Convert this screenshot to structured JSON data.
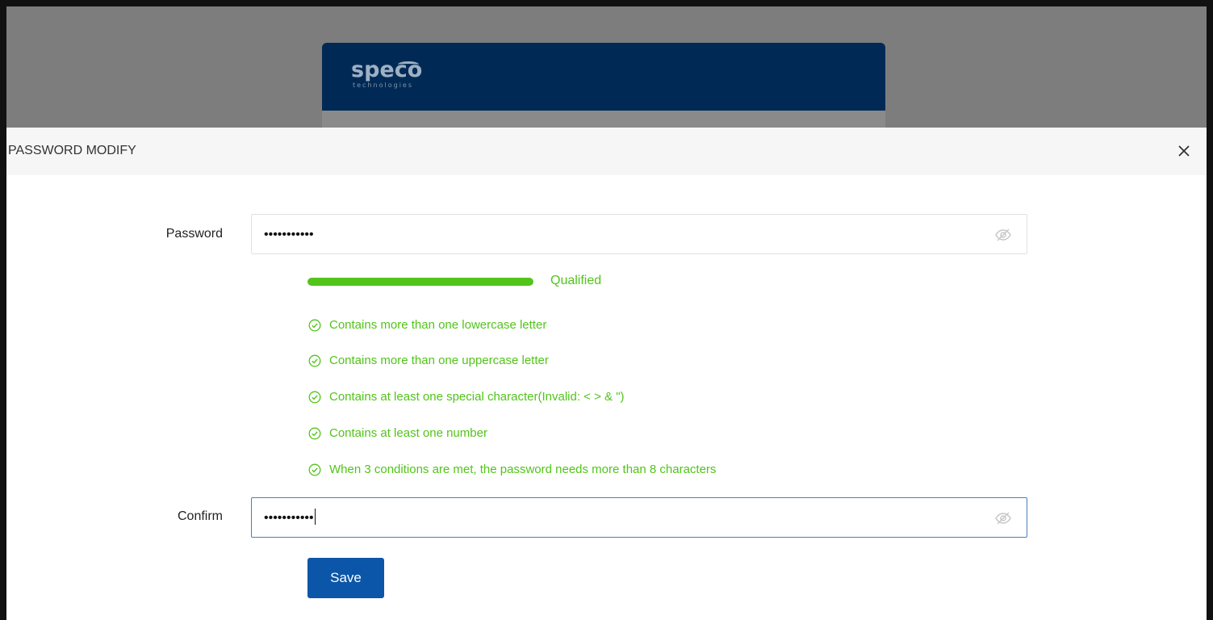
{
  "brand": {
    "logo_text": "speco",
    "logo_subtext": "technologies"
  },
  "modal": {
    "title": "PASSWORD MODIFY",
    "close_symbol": "×"
  },
  "form": {
    "password": {
      "label": "Password",
      "value": "•••••••••••",
      "toggle_icon": "eye-slash-icon"
    },
    "strength": {
      "label": "Qualified",
      "level_percent": 100,
      "color": "#52c41a"
    },
    "rules": [
      {
        "text": "Contains more than one lowercase letter",
        "met": true
      },
      {
        "text": "Contains more than one uppercase letter",
        "met": true
      },
      {
        "text": "Contains at least one special character(Invalid: < > & \")",
        "met": true
      },
      {
        "text": "Contains at least one number",
        "met": true
      },
      {
        "text": "When 3 conditions are met, the password needs more than 8 characters",
        "met": true
      }
    ],
    "confirm": {
      "label": "Confirm",
      "value": "•••••••••••",
      "toggle_icon": "eye-slash-icon"
    },
    "save_label": "Save"
  },
  "colors": {
    "brand_header": "#002a55",
    "success": "#52c41a",
    "primary_button": "#0b56a8"
  }
}
